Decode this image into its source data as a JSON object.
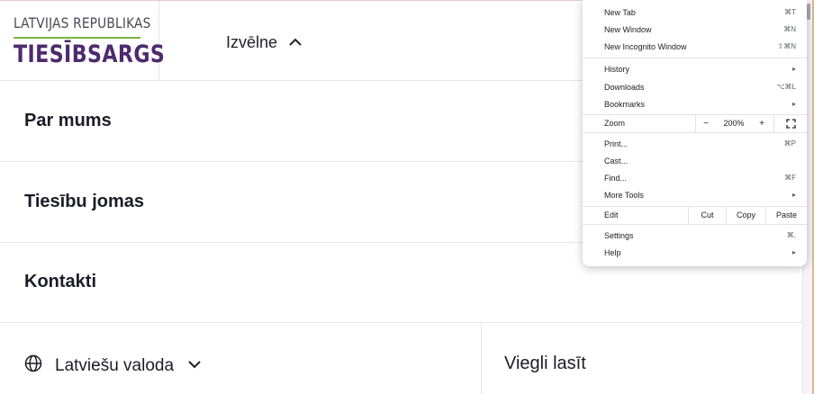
{
  "logo": {
    "top_text": "LATVIJAS REPUBLIKAS",
    "main_text": "TIESĪBSARGS",
    "accent_color": "#7cb342",
    "brand_color": "#4e2a6e"
  },
  "header": {
    "menu_label": "Izvēlne",
    "menu_icon": "chevron-up-icon"
  },
  "nav": {
    "items": [
      {
        "label": "Par mums"
      },
      {
        "label": "Tiesību jomas"
      },
      {
        "label": "Kontakti"
      }
    ]
  },
  "footer": {
    "language_label": "Latviešu valoda",
    "language_icon": "globe-icon",
    "easy_read_label": "Viegli lasīt"
  },
  "browser_menu": {
    "items": [
      {
        "label": "New Tab",
        "shortcut": "⌘T"
      },
      {
        "label": "New Window",
        "shortcut": "⌘N"
      },
      {
        "label": "New Incognito Window",
        "shortcut": "⇧⌘N"
      },
      {
        "label": "History",
        "shortcut": "▸"
      },
      {
        "label": "Downloads",
        "shortcut": "⌥⌘L"
      },
      {
        "label": "Bookmarks",
        "shortcut": "▸"
      },
      {
        "label": "Print...",
        "shortcut": "⌘P"
      },
      {
        "label": "Cast...",
        "shortcut": ""
      },
      {
        "label": "Find...",
        "shortcut": "⌘F"
      },
      {
        "label": "More Tools",
        "shortcut": "▸"
      },
      {
        "label": "Settings",
        "shortcut": "⌘,"
      },
      {
        "label": "Help",
        "shortcut": "▸"
      }
    ],
    "zoom": {
      "label": "Zoom",
      "minus": "−",
      "value": "200%",
      "plus": "+"
    },
    "edit": {
      "label": "Edit",
      "cut": "Cut",
      "copy": "Copy",
      "paste": "Paste"
    }
  }
}
